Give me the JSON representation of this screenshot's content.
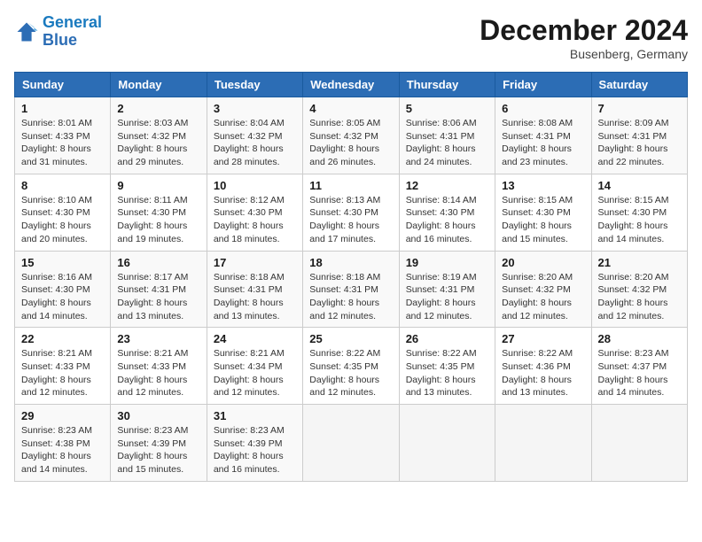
{
  "logo": {
    "line1": "General",
    "line2": "Blue"
  },
  "title": "December 2024",
  "location": "Busenberg, Germany",
  "days_of_week": [
    "Sunday",
    "Monday",
    "Tuesday",
    "Wednesday",
    "Thursday",
    "Friday",
    "Saturday"
  ],
  "weeks": [
    [
      {
        "day": "1",
        "sunrise": "8:01 AM",
        "sunset": "4:33 PM",
        "daylight": "8 hours and 31 minutes."
      },
      {
        "day": "2",
        "sunrise": "8:03 AM",
        "sunset": "4:32 PM",
        "daylight": "8 hours and 29 minutes."
      },
      {
        "day": "3",
        "sunrise": "8:04 AM",
        "sunset": "4:32 PM",
        "daylight": "8 hours and 28 minutes."
      },
      {
        "day": "4",
        "sunrise": "8:05 AM",
        "sunset": "4:32 PM",
        "daylight": "8 hours and 26 minutes."
      },
      {
        "day": "5",
        "sunrise": "8:06 AM",
        "sunset": "4:31 PM",
        "daylight": "8 hours and 24 minutes."
      },
      {
        "day": "6",
        "sunrise": "8:08 AM",
        "sunset": "4:31 PM",
        "daylight": "8 hours and 23 minutes."
      },
      {
        "day": "7",
        "sunrise": "8:09 AM",
        "sunset": "4:31 PM",
        "daylight": "8 hours and 22 minutes."
      }
    ],
    [
      {
        "day": "8",
        "sunrise": "8:10 AM",
        "sunset": "4:30 PM",
        "daylight": "8 hours and 20 minutes."
      },
      {
        "day": "9",
        "sunrise": "8:11 AM",
        "sunset": "4:30 PM",
        "daylight": "8 hours and 19 minutes."
      },
      {
        "day": "10",
        "sunrise": "8:12 AM",
        "sunset": "4:30 PM",
        "daylight": "8 hours and 18 minutes."
      },
      {
        "day": "11",
        "sunrise": "8:13 AM",
        "sunset": "4:30 PM",
        "daylight": "8 hours and 17 minutes."
      },
      {
        "day": "12",
        "sunrise": "8:14 AM",
        "sunset": "4:30 PM",
        "daylight": "8 hours and 16 minutes."
      },
      {
        "day": "13",
        "sunrise": "8:15 AM",
        "sunset": "4:30 PM",
        "daylight": "8 hours and 15 minutes."
      },
      {
        "day": "14",
        "sunrise": "8:15 AM",
        "sunset": "4:30 PM",
        "daylight": "8 hours and 14 minutes."
      }
    ],
    [
      {
        "day": "15",
        "sunrise": "8:16 AM",
        "sunset": "4:30 PM",
        "daylight": "8 hours and 14 minutes."
      },
      {
        "day": "16",
        "sunrise": "8:17 AM",
        "sunset": "4:31 PM",
        "daylight": "8 hours and 13 minutes."
      },
      {
        "day": "17",
        "sunrise": "8:18 AM",
        "sunset": "4:31 PM",
        "daylight": "8 hours and 13 minutes."
      },
      {
        "day": "18",
        "sunrise": "8:18 AM",
        "sunset": "4:31 PM",
        "daylight": "8 hours and 12 minutes."
      },
      {
        "day": "19",
        "sunrise": "8:19 AM",
        "sunset": "4:31 PM",
        "daylight": "8 hours and 12 minutes."
      },
      {
        "day": "20",
        "sunrise": "8:20 AM",
        "sunset": "4:32 PM",
        "daylight": "8 hours and 12 minutes."
      },
      {
        "day": "21",
        "sunrise": "8:20 AM",
        "sunset": "4:32 PM",
        "daylight": "8 hours and 12 minutes."
      }
    ],
    [
      {
        "day": "22",
        "sunrise": "8:21 AM",
        "sunset": "4:33 PM",
        "daylight": "8 hours and 12 minutes."
      },
      {
        "day": "23",
        "sunrise": "8:21 AM",
        "sunset": "4:33 PM",
        "daylight": "8 hours and 12 minutes."
      },
      {
        "day": "24",
        "sunrise": "8:21 AM",
        "sunset": "4:34 PM",
        "daylight": "8 hours and 12 minutes."
      },
      {
        "day": "25",
        "sunrise": "8:22 AM",
        "sunset": "4:35 PM",
        "daylight": "8 hours and 12 minutes."
      },
      {
        "day": "26",
        "sunrise": "8:22 AM",
        "sunset": "4:35 PM",
        "daylight": "8 hours and 13 minutes."
      },
      {
        "day": "27",
        "sunrise": "8:22 AM",
        "sunset": "4:36 PM",
        "daylight": "8 hours and 13 minutes."
      },
      {
        "day": "28",
        "sunrise": "8:23 AM",
        "sunset": "4:37 PM",
        "daylight": "8 hours and 14 minutes."
      }
    ],
    [
      {
        "day": "29",
        "sunrise": "8:23 AM",
        "sunset": "4:38 PM",
        "daylight": "8 hours and 14 minutes."
      },
      {
        "day": "30",
        "sunrise": "8:23 AM",
        "sunset": "4:39 PM",
        "daylight": "8 hours and 15 minutes."
      },
      {
        "day": "31",
        "sunrise": "8:23 AM",
        "sunset": "4:39 PM",
        "daylight": "8 hours and 16 minutes."
      },
      null,
      null,
      null,
      null
    ]
  ]
}
